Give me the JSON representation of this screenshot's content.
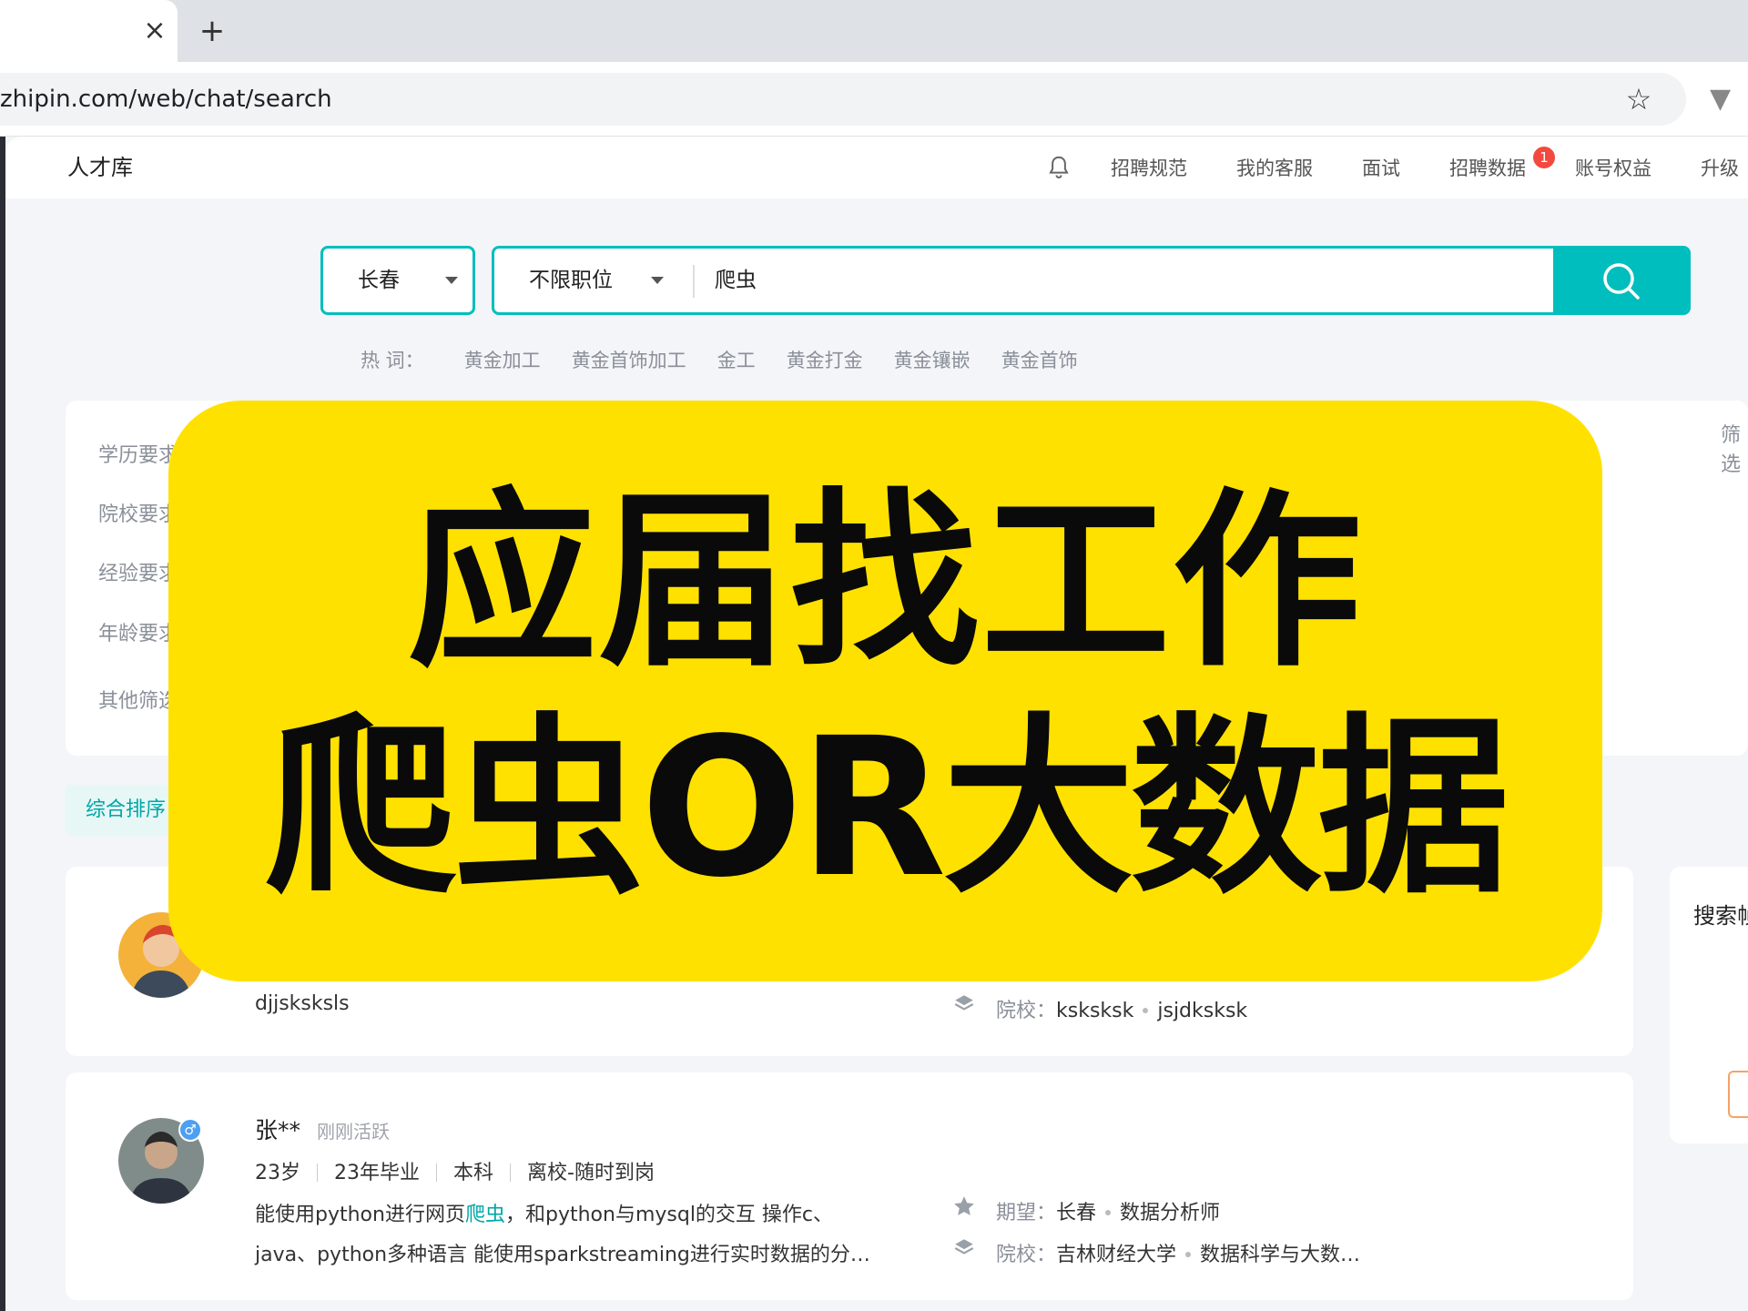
{
  "browser": {
    "url": "zhipin.com/web/chat/search",
    "close_glyph": "×",
    "new_tab_glyph": "+"
  },
  "header": {
    "title": "人才库",
    "nav": [
      {
        "label": "招聘规范"
      },
      {
        "label": "我的客服"
      },
      {
        "label": "面试"
      },
      {
        "label": "招聘数据",
        "badge": "1"
      },
      {
        "label": "账号权益"
      },
      {
        "label": "升级"
      }
    ]
  },
  "search": {
    "city": "长春",
    "position": "不限职位",
    "query": "爬虫",
    "hot_label": "热 词：",
    "hot_words": [
      "黄金加工",
      "黄金首饰加工",
      "金工",
      "黄金打金",
      "黄金镶嵌",
      "黄金首饰"
    ]
  },
  "filters": {
    "labels": [
      "学历要求",
      "院校要求",
      "经验要求",
      "年龄要求",
      "其他筛选"
    ],
    "right_label": "筛选"
  },
  "sort": {
    "active": "综合排序"
  },
  "results": [
    {
      "summary": "djjsksksls",
      "school_label": "院校：",
      "school": "ksksksk",
      "major": "jsjdksksk"
    },
    {
      "name": "张**",
      "active": "刚刚活跃",
      "age": "23岁",
      "grad": "23年毕业",
      "degree": "本科",
      "status": "离校-随时到岗",
      "desc_line1_a": "能使用python进行网页",
      "desc_line1_hl": "爬虫",
      "desc_line1_b": "，和python与mysql的交互 操作c、",
      "desc_line2": "java、python多种语言 能使用sparkstreaming进行实时数据的分…",
      "expect_label": "期望：",
      "expect_city": "长春",
      "expect_job": "数据分析师",
      "school_label": "院校：",
      "school": "吉林财经大学",
      "major": "数据科学与大数…"
    }
  ],
  "side_panel": {
    "title": "搜索帧"
  },
  "overlay": {
    "line1": "应届找工作",
    "line2": "爬虫OR大数据",
    "color": "#ffe100"
  },
  "colors": {
    "accent": "#00bebd",
    "badge": "#f24a3e"
  }
}
